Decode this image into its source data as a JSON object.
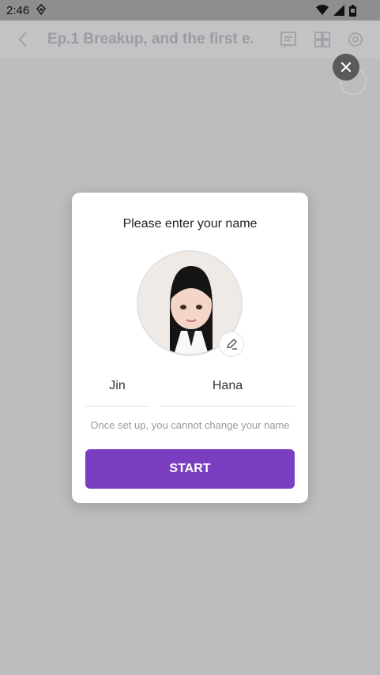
{
  "status_bar": {
    "time": "2:46",
    "icons": [
      "app-notification-icon",
      "wifi-icon",
      "signal-icon",
      "battery-icon"
    ]
  },
  "app_bar": {
    "title": "Ep.1 Breakup, and the first e...",
    "icons": [
      "back-icon",
      "chat-icon",
      "grid-icon",
      "settings-icon"
    ]
  },
  "overlay": {
    "close_icon": "close-icon",
    "sound_icon": "sound-icon"
  },
  "modal": {
    "title": "Please enter your name",
    "first_name": "Jin",
    "last_name": "Hana",
    "hint": "Once set up, you cannot change your name",
    "start_label": "START",
    "avatar_edit_icon": "pencil-icon"
  },
  "colors": {
    "accent": "#7a3fc0",
    "dim_background": "#bdbdbf"
  }
}
